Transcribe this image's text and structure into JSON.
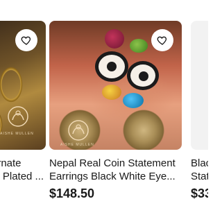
{
  "carousel": {
    "listings": [
      {
        "title": "... Ornate Gold Plated ...",
        "title_visible": "te Gold\nted ...",
        "price": "",
        "image_icon": "gold-hoop-earrings-image"
      },
      {
        "title": "Nepal Real Coin Statement Earrings Black White Eye...",
        "price": "$148.50",
        "image_icon": "coin-bead-earrings-image"
      },
      {
        "title": "Black ... Statement ...",
        "title_visible": "Blac\nStat",
        "price": "$33",
        "image_icon": "earrings-image"
      }
    ],
    "favorite_icon": "heart-icon",
    "watermark_brand": "AISHE MULLEN",
    "colors": {
      "text": "#191919",
      "fav_bg": "#ffffff"
    }
  }
}
